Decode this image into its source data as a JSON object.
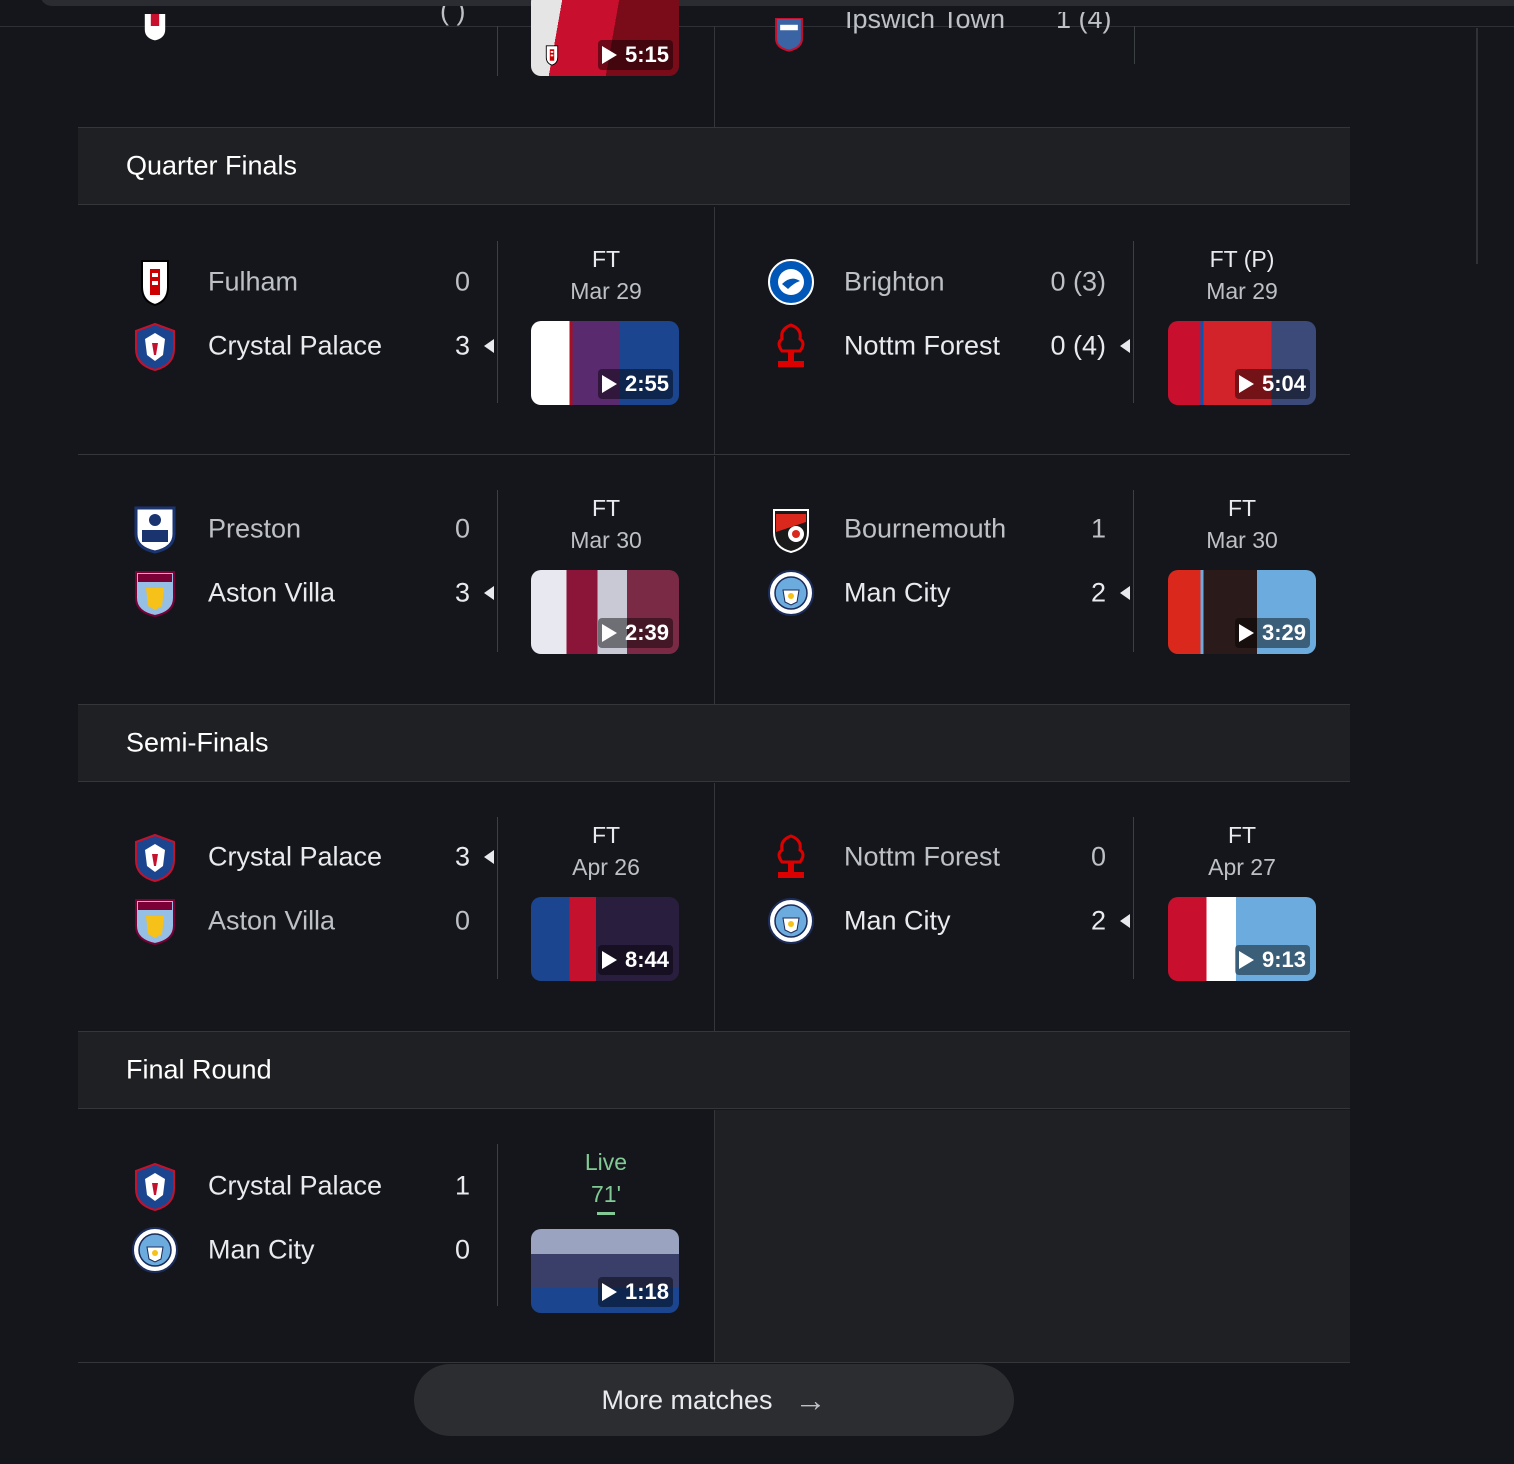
{
  "top_partial": {
    "left_score": "( )",
    "left_duration": "5:15",
    "right_team": "Ipswich Town",
    "right_score": "1 (4)"
  },
  "rounds": {
    "quarter": "Quarter Finals",
    "semi": "Semi-Finals",
    "final": "Final Round"
  },
  "matches": {
    "qf1": {
      "team1": "Fulham",
      "score1": "0",
      "team2": "Crystal Palace",
      "score2": "3",
      "status": "FT",
      "date": "Mar 29",
      "duration": "2:55"
    },
    "qf2": {
      "team1": "Brighton",
      "score1": "0 (3)",
      "team2": "Nottm Forest",
      "score2": "0 (4)",
      "status": "FT (P)",
      "date": "Mar 29",
      "duration": "5:04"
    },
    "qf3": {
      "team1": "Preston",
      "score1": "0",
      "team2": "Aston Villa",
      "score2": "3",
      "status": "FT",
      "date": "Mar 30",
      "duration": "2:39"
    },
    "qf4": {
      "team1": "Bournemouth",
      "score1": "1",
      "team2": "Man City",
      "score2": "2",
      "status": "FT",
      "date": "Mar 30",
      "duration": "3:29"
    },
    "sf1": {
      "team1": "Crystal Palace",
      "score1": "3",
      "team2": "Aston Villa",
      "score2": "0",
      "status": "FT",
      "date": "Apr 26",
      "duration": "8:44"
    },
    "sf2": {
      "team1": "Nottm Forest",
      "score1": "0",
      "team2": "Man City",
      "score2": "2",
      "status": "FT",
      "date": "Apr 27",
      "duration": "9:13"
    },
    "final": {
      "team1": "Crystal Palace",
      "score1": "1",
      "team2": "Man City",
      "score2": "0",
      "status": "Live",
      "minute": "71'",
      "duration": "1:18"
    }
  },
  "more_matches": "More matches",
  "colors": {
    "background": "#15161b",
    "panel": "#1f2023",
    "live": "#81c995"
  }
}
